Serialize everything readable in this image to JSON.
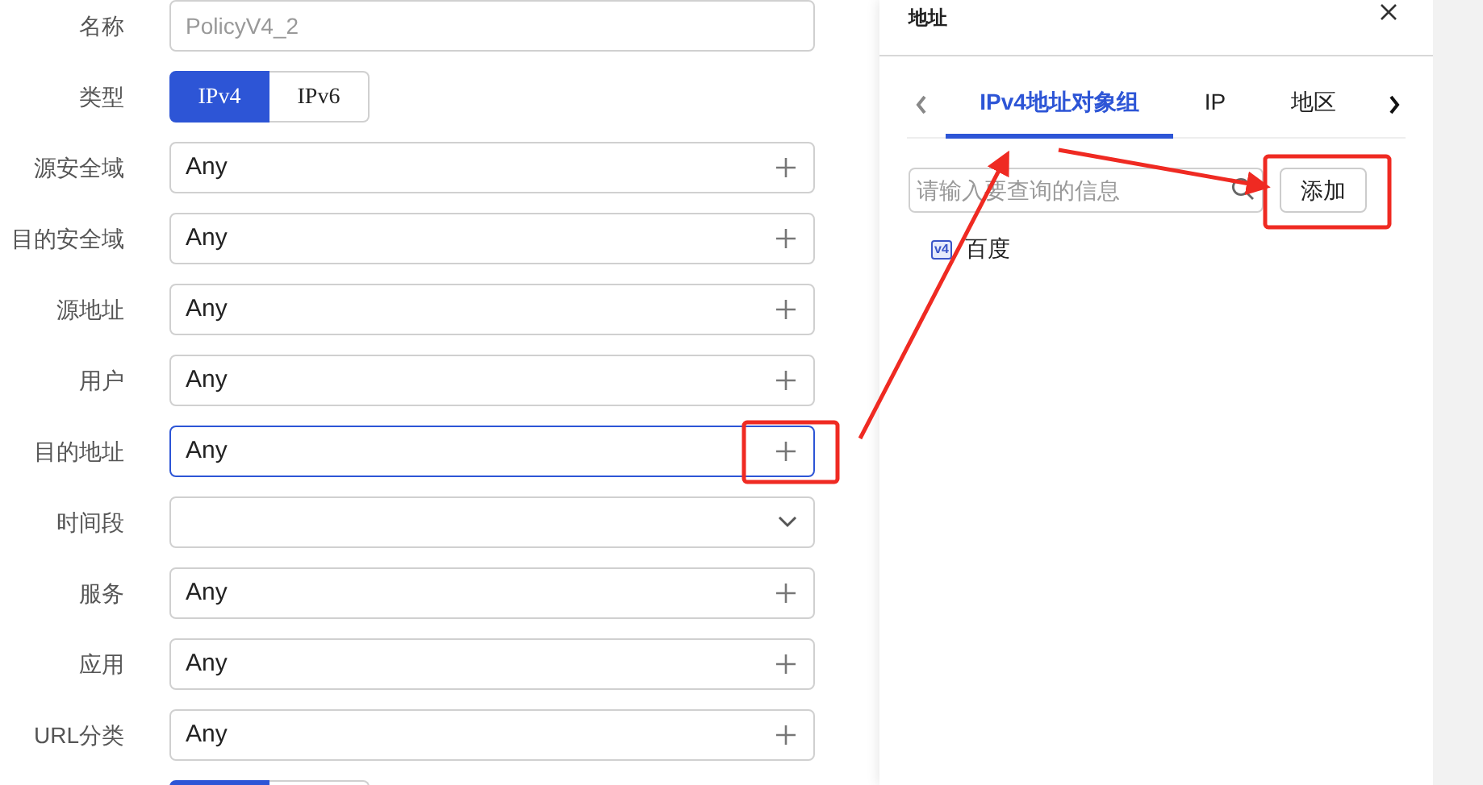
{
  "form": {
    "fields": [
      {
        "kind": "text",
        "label": "名称",
        "placeholder": "PolicyV4_2"
      },
      {
        "kind": "segmented",
        "label": "类型",
        "options": [
          {
            "label": "IPv4",
            "selected": true
          },
          {
            "label": "IPv6",
            "selected": false
          }
        ]
      },
      {
        "kind": "picker",
        "label": "源安全域",
        "value": "Any",
        "focused": false
      },
      {
        "kind": "picker",
        "label": "目的安全域",
        "value": "Any",
        "focused": false
      },
      {
        "kind": "picker",
        "label": "源地址",
        "value": "Any",
        "focused": false
      },
      {
        "kind": "picker",
        "label": "用户",
        "value": "Any",
        "focused": false
      },
      {
        "kind": "picker",
        "label": "目的地址",
        "value": "Any",
        "focused": true
      },
      {
        "kind": "select",
        "label": "时间段"
      },
      {
        "kind": "picker",
        "label": "服务",
        "value": "Any",
        "focused": false
      },
      {
        "kind": "picker",
        "label": "应用",
        "value": "Any",
        "focused": false
      },
      {
        "kind": "picker",
        "label": "URL分类",
        "value": "Any",
        "focused": false
      },
      {
        "kind": "segmented",
        "options": [
          {
            "selected": true
          },
          {
            "selected": false
          }
        ]
      }
    ]
  },
  "panel": {
    "title": "地址",
    "tabs": [
      {
        "label": "IPv4地址对象组",
        "selected": true
      },
      {
        "label": "IP",
        "selected": false
      },
      {
        "label": "地区",
        "selected": false
      }
    ],
    "search": {
      "placeholder": "请输入要查询的信息"
    },
    "add_button": "添加",
    "items": [
      {
        "badge": "v4",
        "label": "百度"
      }
    ]
  }
}
